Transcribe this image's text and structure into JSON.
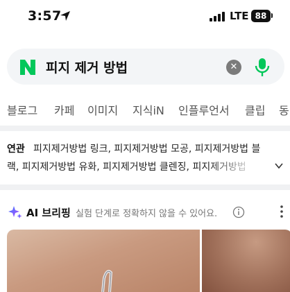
{
  "status_bar": {
    "time": "3:57",
    "network": "LTE",
    "battery": "88"
  },
  "search": {
    "logo": "N",
    "query": "피지 제거 방법",
    "clear_icon": "close-icon",
    "mic_icon": "mic-icon"
  },
  "tabs": [
    "블로그",
    "카페",
    "이미지",
    "지식iN",
    "인플루언서",
    "클립",
    "동"
  ],
  "related": {
    "label": "연관",
    "line1": "피지제거방법 링크, 피지제거방법 모공, 피지제거방법 블",
    "line2": "랙, 피지제거방법 유화, 피지제거방법 클렌징, 피지제거방법"
  },
  "briefing": {
    "title": "AI 브리핑",
    "disclaimer": "실험 단계로 정확하지 않을 수 있어요."
  },
  "colors": {
    "naver_green": "#03c75a",
    "search_bg": "#f3f5f7",
    "divider": "#f0f1f3"
  }
}
